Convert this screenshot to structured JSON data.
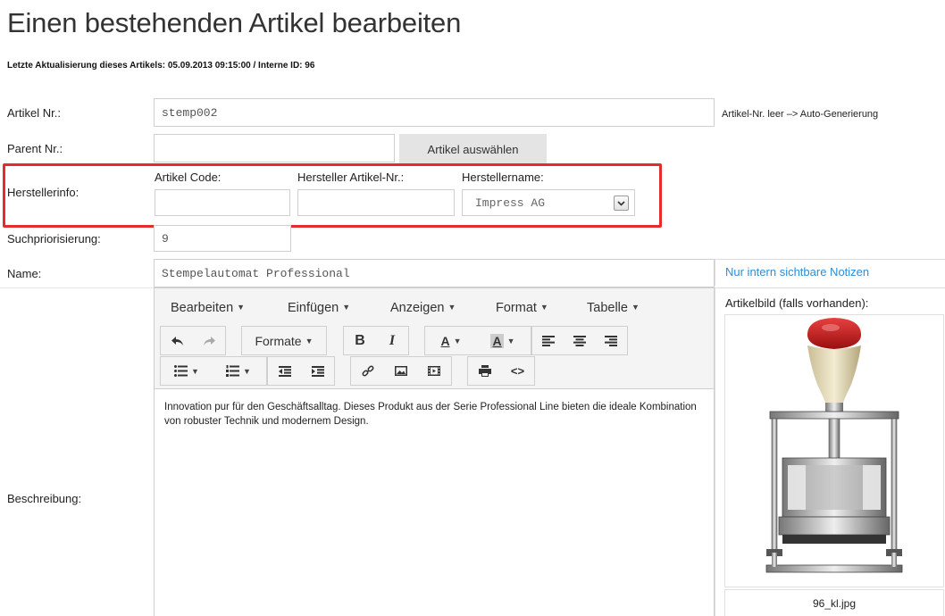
{
  "page": {
    "title": "Einen bestehenden Artikel bearbeiten",
    "last_update": "Letzte Aktualisierung dieses Artikels: 05.09.2013 09:15:00 / Interne ID: 96"
  },
  "form": {
    "artikel_nr": {
      "label": "Artikel Nr.:",
      "value": "stemp002",
      "hint": "Artikel-Nr. leer –> Auto-Generierung"
    },
    "parent_nr": {
      "label": "Parent Nr.:",
      "value": "",
      "button": "Artikel auswählen"
    },
    "herstellerinfo": {
      "label": "Herstellerinfo:",
      "artikel_code": {
        "label": "Artikel Code:",
        "value": ""
      },
      "hersteller_artikel_nr": {
        "label": "Hersteller Artikel-Nr.:",
        "value": ""
      },
      "herstellername": {
        "label": "Herstellername:",
        "selected": "Impress AG"
      },
      "highlight_color": "#e52b2b"
    },
    "suchpriorisierung": {
      "label": "Suchpriorisierung:",
      "value": "9"
    },
    "name": {
      "label": "Name:",
      "value": "Stempelautomat Professional"
    },
    "beschreibung": {
      "label": "Beschreibung:"
    }
  },
  "editor": {
    "menus": [
      {
        "label": "Bearbeiten"
      },
      {
        "label": "Einfügen"
      },
      {
        "label": "Anzeigen"
      },
      {
        "label": "Format"
      },
      {
        "label": "Tabelle"
      }
    ],
    "formats_label": "Formate",
    "bold_label": "B",
    "italic_label": "I",
    "text_color_label": "A",
    "bg_color_label": "A",
    "code_label": "<>",
    "content": "Innovation pur für den Geschäftsalltag. Dieses Produkt aus der Serie Professional Line bieten die ideale Kombination von robuster Technik und modernem Design."
  },
  "side": {
    "notes_link": "Nur intern sichtbare Notizen",
    "notes_link_color": "#2d8ed6",
    "image_label": "Artikelbild (falls vorhanden):",
    "image_caption": "96_kl.jpg"
  }
}
